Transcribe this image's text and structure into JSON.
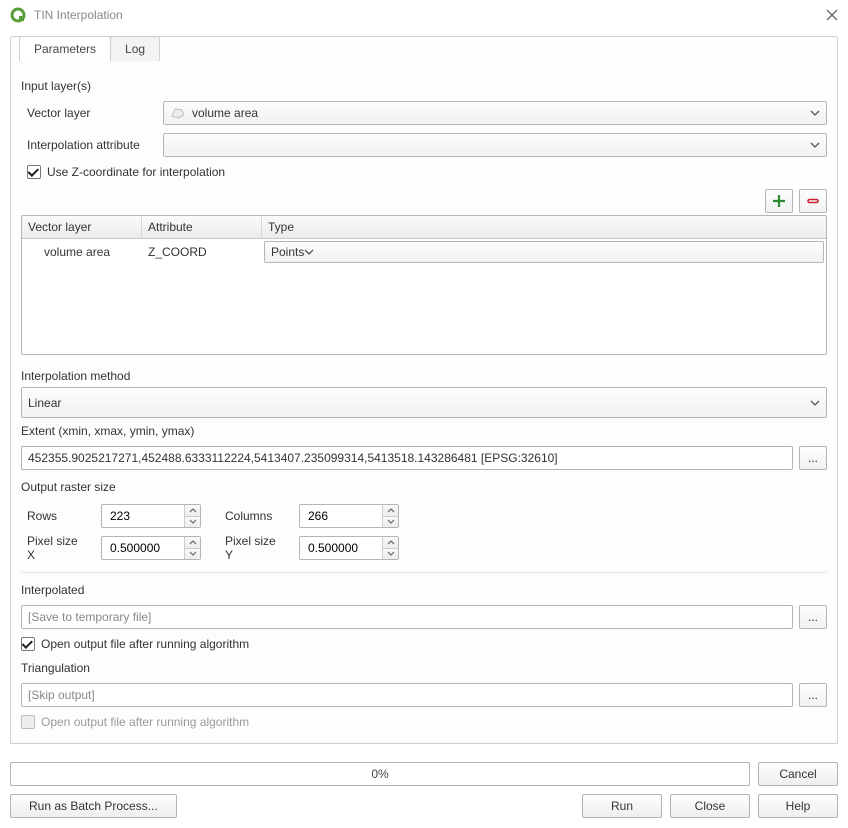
{
  "window": {
    "title": "TIN Interpolation"
  },
  "tabs": {
    "parameters": "Parameters",
    "log": "Log"
  },
  "sections": {
    "input_layers": "Input layer(s)",
    "interp_method": "Interpolation method",
    "extent": "Extent (xmin, xmax, ymin, ymax)",
    "output_size": "Output raster size",
    "interpolated": "Interpolated",
    "triangulation": "Triangulation"
  },
  "labels": {
    "vector_layer": "Vector layer",
    "interp_attr": "Interpolation attribute",
    "use_z": "Use Z-coordinate for interpolation",
    "rows": "Rows",
    "columns": "Columns",
    "px_x": "Pixel size X",
    "px_y": "Pixel size Y",
    "open_after_1": "Open output file after running algorithm",
    "open_after_2": "Open output file after running algorithm"
  },
  "values": {
    "vector_layer_selected": "volume area",
    "interp_attr_selected": "",
    "use_z_checked": true,
    "interp_method_selected": "Linear",
    "extent": "452355.9025217271,452488.6333112224,5413407.235099314,5413518.143286481 [EPSG:32610]",
    "rows": "223",
    "columns": "266",
    "px_x": "0.500000",
    "px_y": "0.500000",
    "interpolated_placeholder": "[Save to temporary file]",
    "open_after_1_checked": true,
    "triangulation_placeholder": "[Skip output]",
    "open_after_2_checked": false,
    "progress": "0%"
  },
  "table": {
    "headers": {
      "vector": "Vector layer",
      "attribute": "Attribute",
      "type": "Type"
    },
    "rows": [
      {
        "vector": "volume area",
        "attribute": "Z_COORD",
        "type": "Points"
      }
    ]
  },
  "buttons": {
    "cancel": "Cancel",
    "batch": "Run as Batch Process...",
    "run": "Run",
    "close": "Close",
    "help": "Help",
    "dots": "..."
  },
  "icons": {
    "add": "plus-icon",
    "remove": "minus-icon",
    "layer": "polygon-icon",
    "caret": "caret-down-icon",
    "close_window": "close-icon",
    "logo": "qgis-logo-icon"
  }
}
